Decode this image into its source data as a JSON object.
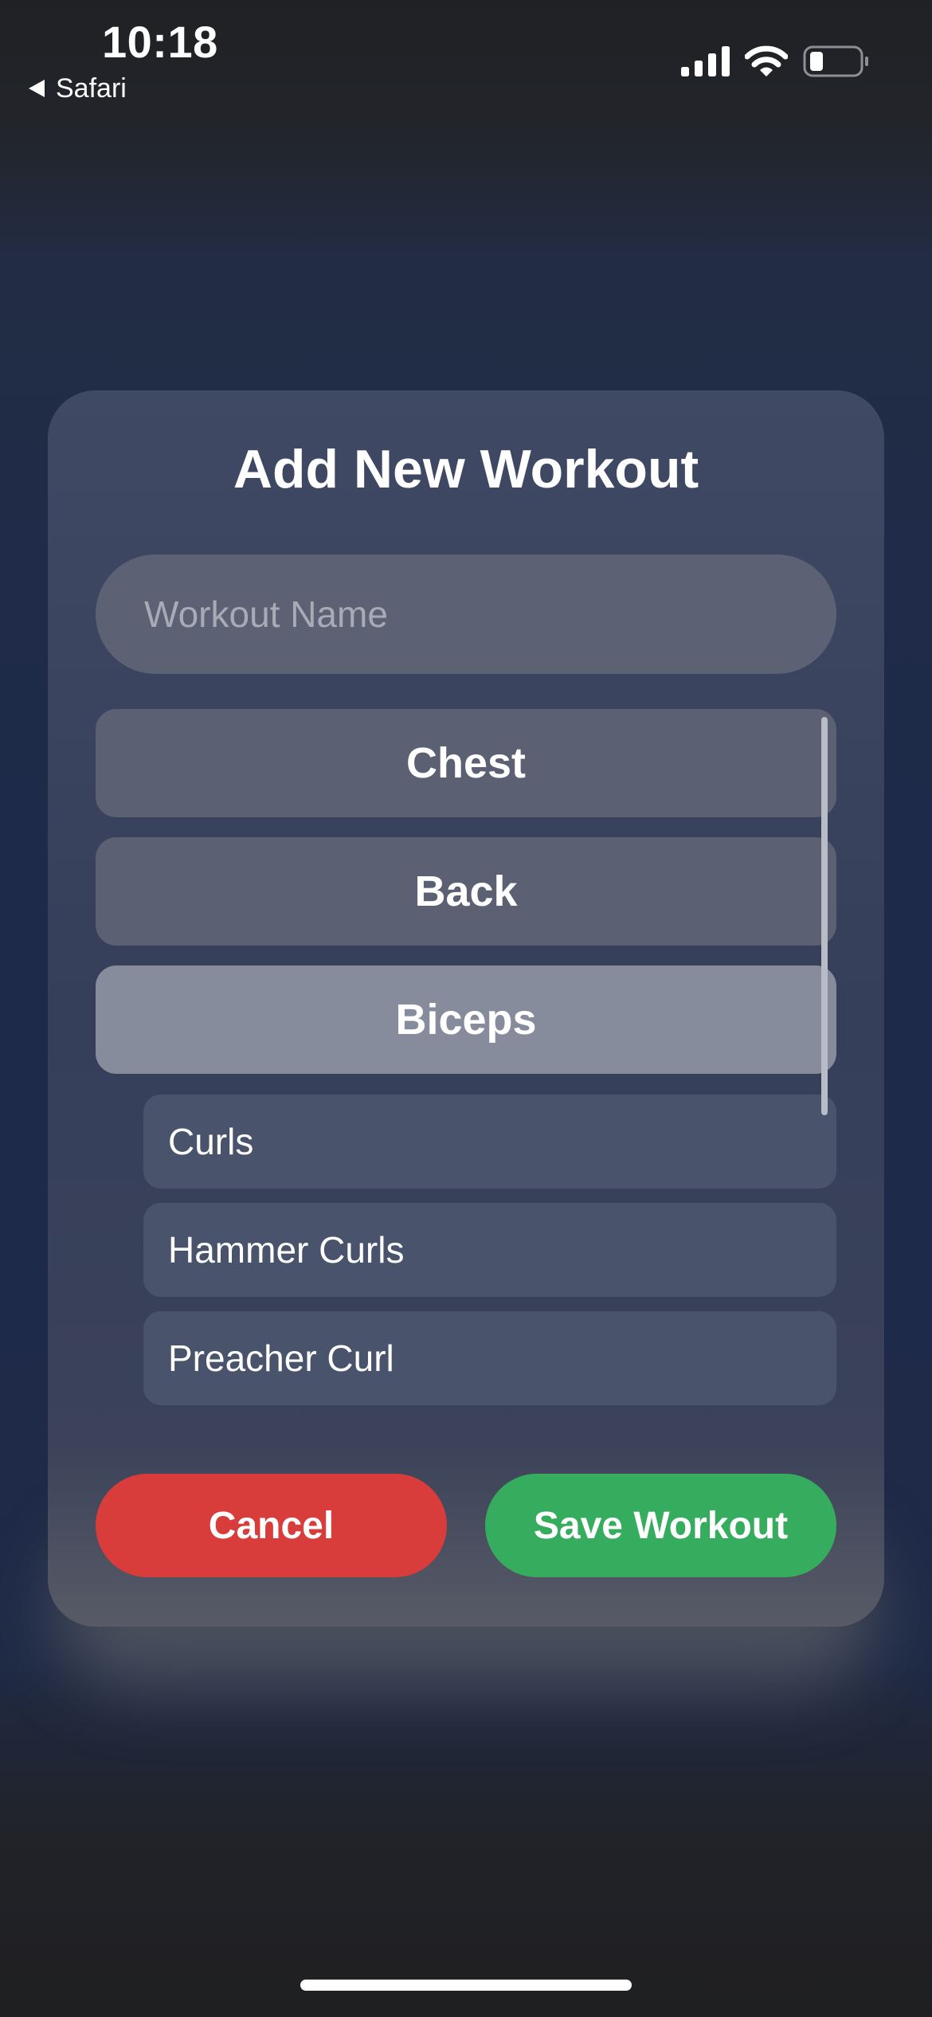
{
  "status_bar": {
    "time": "10:18",
    "back_app": "Safari",
    "icons": [
      "cellular-signal-icon",
      "wifi-icon",
      "battery-icon"
    ]
  },
  "modal": {
    "title": "Add New Workout",
    "name_input": {
      "value": "",
      "placeholder": "Workout Name"
    },
    "muscle_groups": [
      {
        "label": "Chest",
        "selected": false
      },
      {
        "label": "Back",
        "selected": false
      },
      {
        "label": "Biceps",
        "selected": true
      }
    ],
    "exercises": [
      "Curls",
      "Hammer Curls",
      "Preacher Curl"
    ],
    "cancel_label": "Cancel",
    "save_label": "Save Workout"
  },
  "colors": {
    "cancel": "#d83c3b",
    "save": "#36ad5e",
    "selected_group": "#868c9c",
    "group": "#5b6172",
    "exercise_row": "#4a536c"
  }
}
